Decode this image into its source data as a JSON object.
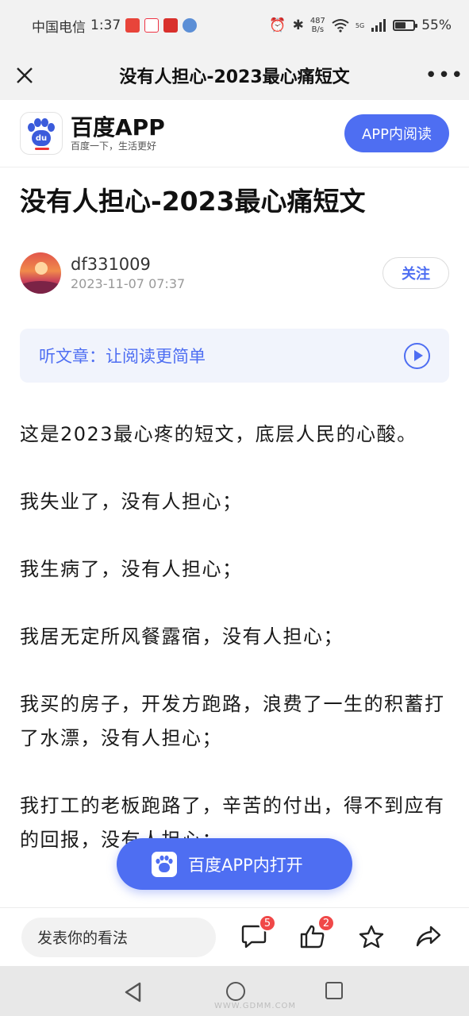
{
  "status_bar": {
    "carrier": "中国电信",
    "time": "1:37",
    "net_speed_value": "487",
    "net_speed_unit": "B/s",
    "signal_label": "5G",
    "battery_percent": "55%",
    "battery_level": 0.55
  },
  "nav": {
    "title": "没有人担心-2023最心痛短文",
    "more_label": "•••"
  },
  "banner": {
    "brand_name": "百度APP",
    "slogan": "百度一下，生活更好",
    "logo_text": "du",
    "open_label": "APP内阅读"
  },
  "article": {
    "title": "没有人担心-2023最心痛短文",
    "author": "df331009",
    "date": "2023-11-07 07:37",
    "follow_label": "关注",
    "listen_label": "听文章：让阅读更简单",
    "paragraphs": [
      "这是2023最心疼的短文，底层人民的心酸。",
      "我失业了，没有人担心；",
      "我生病了，没有人担心；",
      "我居无定所风餐露宿，没有人担心；",
      "我买的房子，开发方跑路，浪费了一生的积蓄打了水漂，没有人担心；",
      "我打工的老板跑路了，辛苦的付出，得不到应有的回报，没有人担心；"
    ]
  },
  "float_button": {
    "label": "百度APP内打开"
  },
  "bottom_bar": {
    "comment_placeholder": "发表你的看法",
    "comment_count": "5",
    "like_count": "2"
  },
  "watermark": "WWW.GDMM.COM",
  "colors": {
    "accent": "#4e6ef2",
    "badge": "#f04848",
    "listen_bg": "#f1f4fc"
  }
}
